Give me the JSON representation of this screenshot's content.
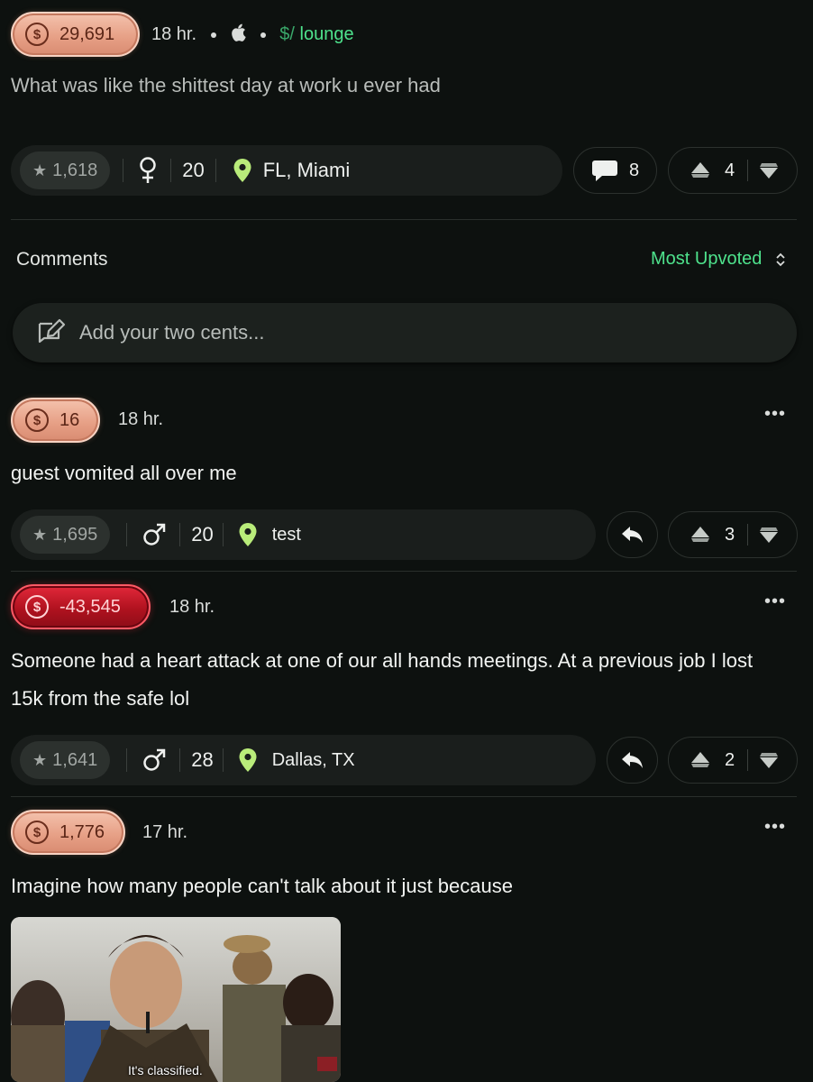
{
  "post": {
    "coins": "29,691",
    "time": "18 hr.",
    "community_prefix": "$/",
    "community": "lounge",
    "body": "What was like the shittest day at work u ever had",
    "karma": "1,618",
    "gender_icon": "female-icon",
    "age": "20",
    "location": "FL, Miami",
    "comments_count": "8",
    "upvotes": "4"
  },
  "comments_header": {
    "title": "Comments",
    "sort_label": "Most Upvoted"
  },
  "composer": {
    "placeholder": "Add your two cents..."
  },
  "comments": [
    {
      "coins": "16",
      "time": "18 hr.",
      "body": "guest vomited all over me",
      "karma": "1,695",
      "gender_icon": "male-icon",
      "age": "20",
      "location": "test",
      "upvotes": "3"
    },
    {
      "coins": "-43,545",
      "time": "18 hr.",
      "body_line1": "Someone had a heart attack at one of our all hands meetings. At a previous job I lost",
      "body_line2": "15k from the safe lol",
      "karma": "1,641",
      "gender_icon": "male-icon",
      "age": "28",
      "location": "Dallas, TX",
      "upvotes": "2"
    },
    {
      "coins": "1,776",
      "time": "17 hr.",
      "body": "Imagine how many people can't talk about it just because",
      "image_caption": "It's classified."
    }
  ],
  "colors": {
    "background": "#0d110f",
    "accent_green": "#4ee28c",
    "coin_positive": "#e7a187",
    "coin_negative": "#c4172a"
  }
}
